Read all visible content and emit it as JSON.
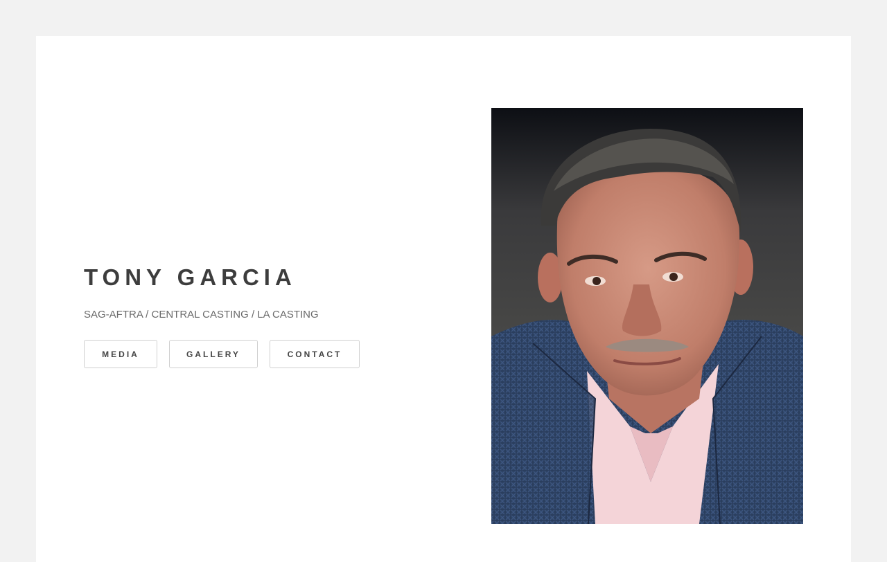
{
  "profile": {
    "name": "TONY GARCIA",
    "affiliations": "SAG-AFTRA / CENTRAL CASTING / LA CASTING"
  },
  "nav": {
    "media_label": "MEDIA",
    "gallery_label": "GALLERY",
    "contact_label": "CONTACT"
  },
  "headshot": {
    "alt": "Headshot of Tony Garcia"
  }
}
